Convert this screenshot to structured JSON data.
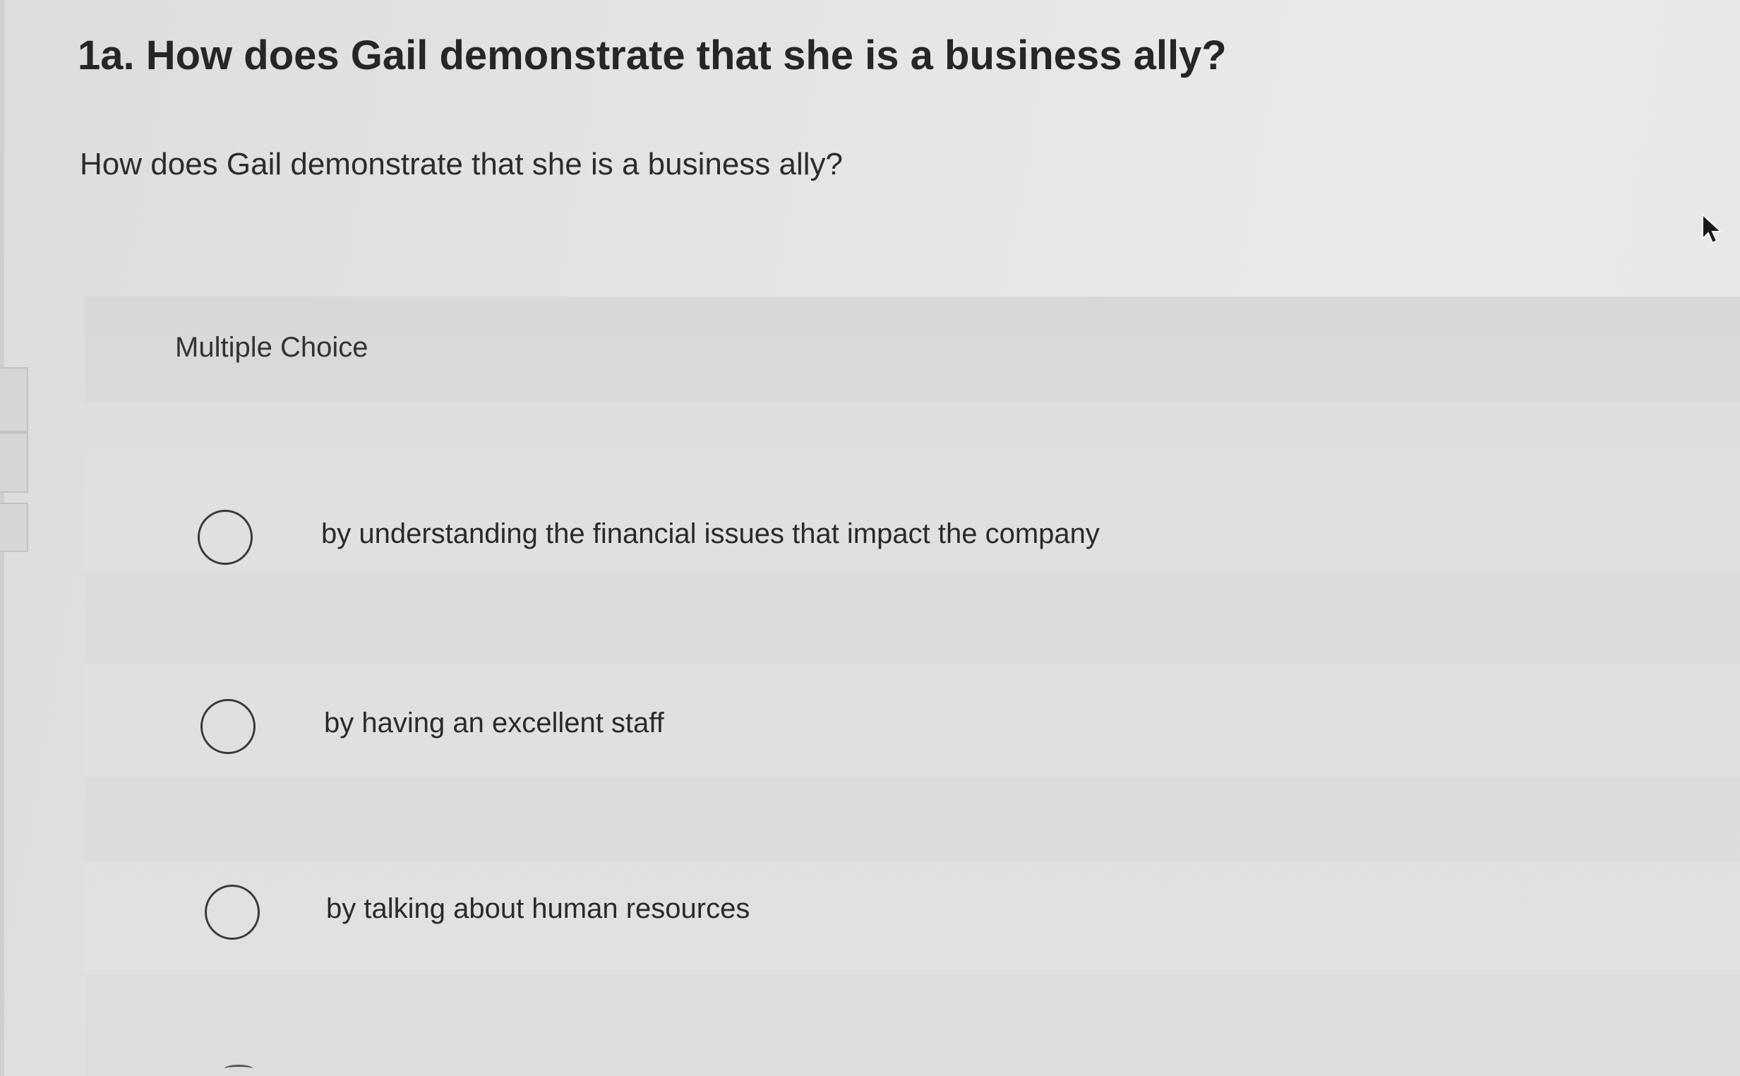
{
  "question": {
    "title": "1a. How does Gail demonstrate that she is a business ally?",
    "text": "How does Gail demonstrate that she is a business ally?"
  },
  "choices": {
    "label": "Multiple Choice",
    "options": [
      {
        "text": "by understanding the financial issues that impact the company"
      },
      {
        "text": "by having an excellent staff"
      },
      {
        "text": "by talking about human resources"
      }
    ]
  }
}
